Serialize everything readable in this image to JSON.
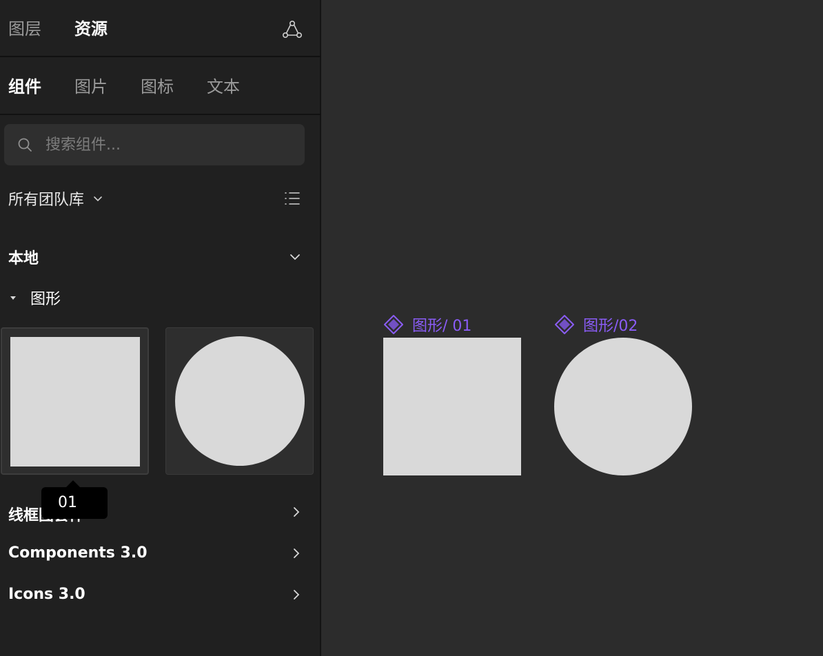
{
  "sidebar": {
    "top_tabs": [
      {
        "label": "图层",
        "active": false
      },
      {
        "label": "资源",
        "active": true
      }
    ],
    "sub_tabs": [
      {
        "label": "组件",
        "active": true
      },
      {
        "label": "图片",
        "active": false
      },
      {
        "label": "图标",
        "active": false
      },
      {
        "label": "文本",
        "active": false
      }
    ],
    "search": {
      "placeholder": "搜索组件..."
    },
    "library_select": "所有团队库",
    "local_section": "本地",
    "group": {
      "name": "图形",
      "items": [
        "01",
        "02"
      ]
    },
    "tooltip": "01",
    "libraries": [
      {
        "label": "线框图套件"
      },
      {
        "label": "Components 3.0"
      },
      {
        "label": "Icons 3.0"
      }
    ]
  },
  "canvas": {
    "components": [
      {
        "label": "图形/ 01",
        "shape": "square"
      },
      {
        "label": "图形/02",
        "shape": "circle"
      }
    ],
    "accent_color": "#8a5cf6"
  }
}
